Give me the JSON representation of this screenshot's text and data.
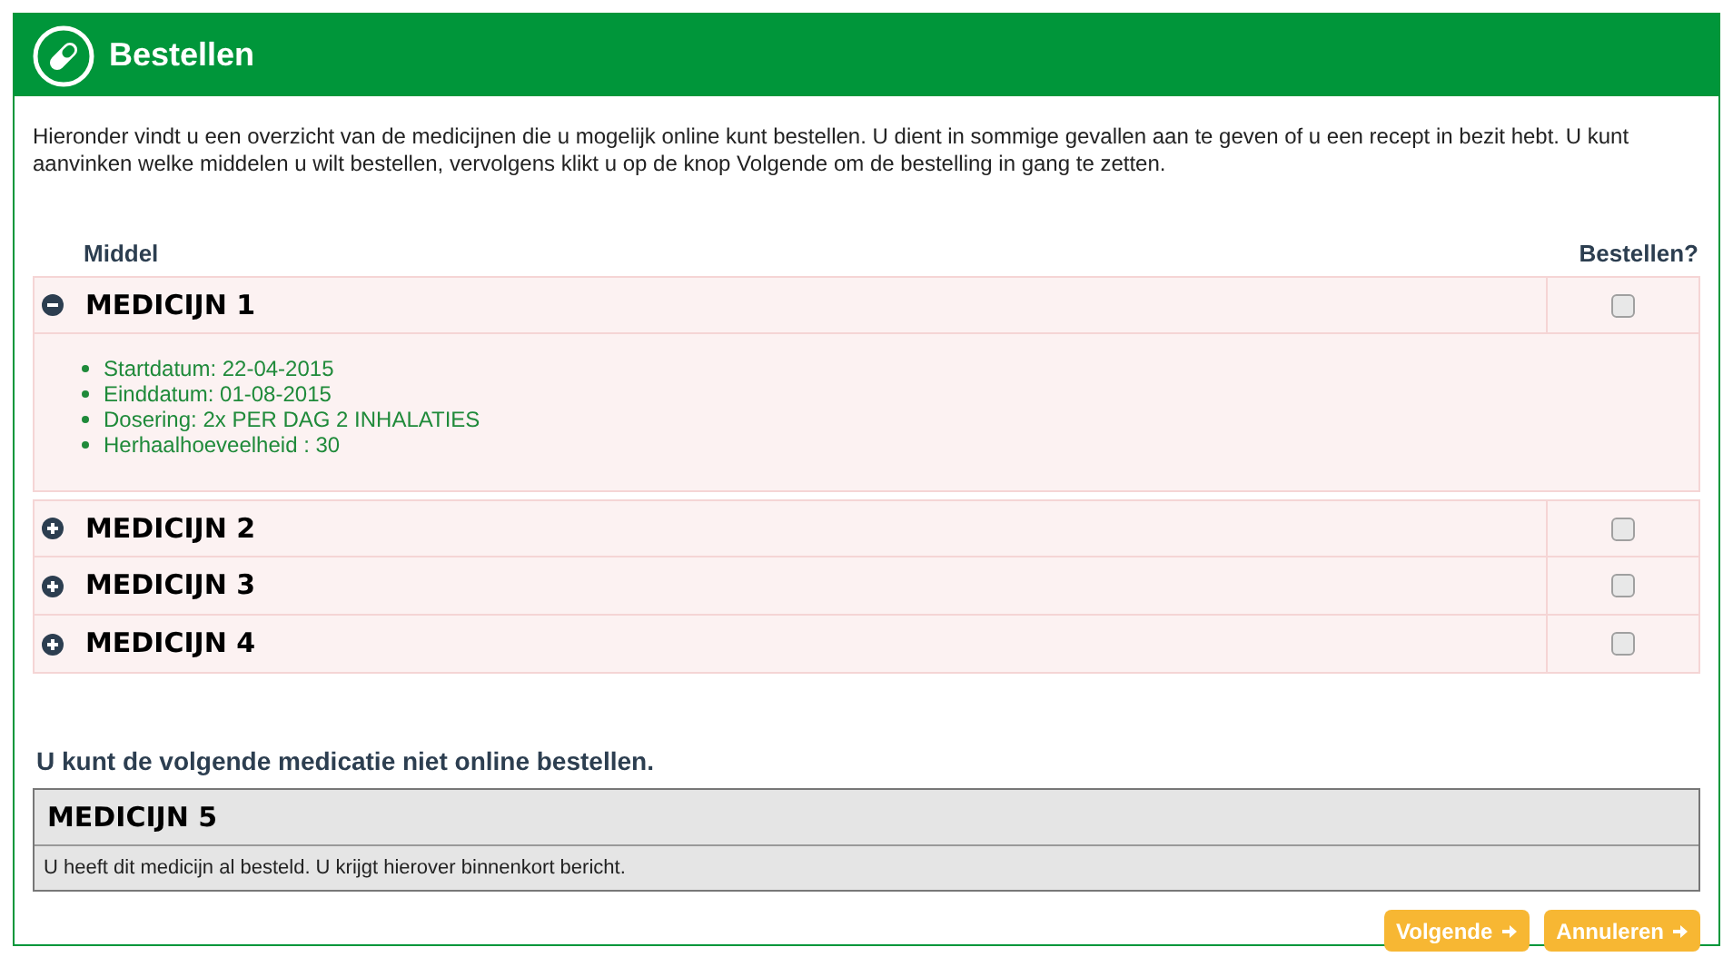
{
  "header": {
    "title": "Bestellen"
  },
  "intro": "Hieronder vindt u een overzicht van de medicijnen die u mogelijk online kunt bestellen. U dient in sommige gevallen aan te geven of u een recept in bezit hebt. U kunt aanvinken welke middelen u wilt bestellen, vervolgens klikt u op de knop Volgende om de bestelling in gang te zetten.",
  "table": {
    "columns": [
      "Middel",
      "Bestellen?"
    ],
    "rows": [
      {
        "name": "MEDICIJN 1",
        "expanded": true,
        "checked": false,
        "details": [
          "Startdatum: 22-04-2015",
          "Einddatum: 01-08-2015",
          "Dosering: 2x PER DAG 2 INHALATIES",
          "Herhaalhoeveelheid : 30"
        ]
      },
      {
        "name": "MEDICIJN 2",
        "expanded": false,
        "checked": false
      },
      {
        "name": "MEDICIJN 3",
        "expanded": false,
        "checked": false
      },
      {
        "name": "MEDICIJN 4",
        "expanded": false,
        "checked": false
      }
    ]
  },
  "unavailable": {
    "heading": "U kunt de volgende medicatie niet online bestellen.",
    "items": [
      {
        "name": "MEDICIJN 5",
        "message": "U heeft dit medicijn al besteld. U krijgt hierover binnenkort bericht."
      }
    ]
  },
  "buttons": [
    "Volgende",
    "Annuleren"
  ]
}
